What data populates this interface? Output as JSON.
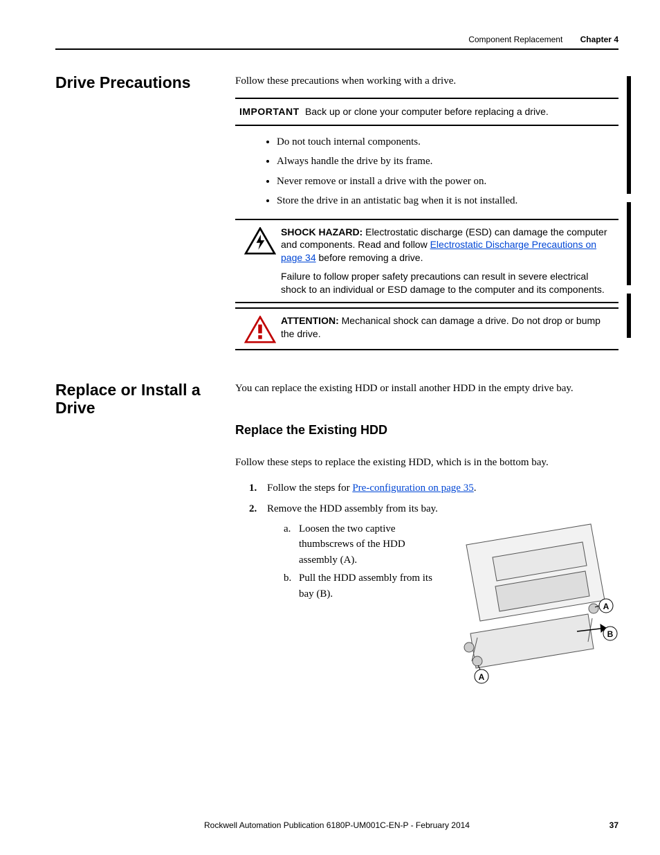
{
  "header": {
    "chapter_title": "Component Replacement",
    "chapter_label": "Chapter 4"
  },
  "section1": {
    "title": "Drive Precautions",
    "intro": "Follow these precautions when working with a drive.",
    "important_label": "IMPORTANT",
    "important_text": "Back up or clone your computer before replacing a drive.",
    "bullets": [
      "Do not touch internal components.",
      "Always handle the drive by its frame.",
      "Never remove or install a drive with the power on.",
      "Store the drive in an antistatic bag when it is not installed."
    ],
    "shock_label": "SHOCK HAZARD:",
    "shock_text_a": " Electrostatic discharge (ESD) can damage the computer and components. Read and follow ",
    "shock_link": "Electrostatic Discharge Precautions on page 34",
    "shock_text_b": " before removing a drive.",
    "shock_para2": "Failure to follow proper safety precautions can result in severe electrical shock to an individual or ESD damage to the computer and its components.",
    "attention_label": "ATTENTION:",
    "attention_text": " Mechanical shock can damage a drive. Do not drop or bump the drive."
  },
  "section2": {
    "title": "Replace or Install a Drive",
    "intro": "You can replace the existing HDD or install another HDD in the empty drive bay.",
    "subheading": "Replace the Existing HDD",
    "sub_intro": "Follow these steps to replace the existing HDD, which is in the bottom bay.",
    "step1_a": "Follow the steps for ",
    "step1_link": "Pre-configuration on page 35",
    "step1_b": ".",
    "step2": "Remove the HDD assembly from its bay.",
    "step2a": "Loosen the two captive thumbscrews of the HDD assembly (A).",
    "step2b": "Pull the HDD assembly from its bay (B).",
    "callout_A": "A",
    "callout_B": "B"
  },
  "footer": {
    "publication": "Rockwell Automation Publication 6180P-UM001C-EN-P - February 2014",
    "page": "37"
  }
}
